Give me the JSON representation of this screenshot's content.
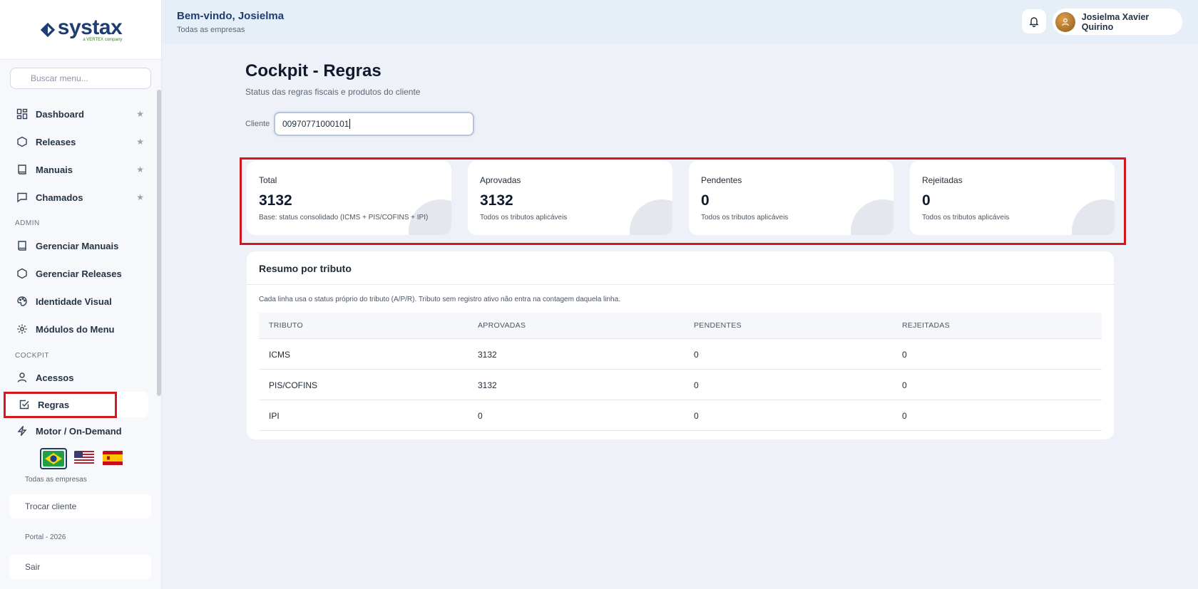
{
  "logo": {
    "text": "systax",
    "sub": "a VERTEX company"
  },
  "sidebar": {
    "search_placeholder": "Buscar menu...",
    "items": [
      {
        "label": "Dashboard",
        "icon": "grid-icon",
        "star": "★"
      },
      {
        "label": "Releases",
        "icon": "hexagon-icon",
        "star": "★"
      },
      {
        "label": "Manuais",
        "icon": "book-icon",
        "star": "★"
      },
      {
        "label": "Chamados",
        "icon": "message-icon",
        "star": "★"
      }
    ],
    "admin_label": "ADMIN",
    "admin_items": [
      {
        "label": "Gerenciar Manuais",
        "icon": "book-icon"
      },
      {
        "label": "Gerenciar Releases",
        "icon": "hexagon-icon"
      },
      {
        "label": "Identidade Visual",
        "icon": "palette-icon"
      },
      {
        "label": "Módulos do Menu",
        "icon": "gear-icon"
      }
    ],
    "cockpit_label": "COCKPIT",
    "cockpit_items": [
      {
        "label": "Acessos",
        "icon": "user-icon"
      },
      {
        "label": "Regras",
        "icon": "checkbox-icon"
      },
      {
        "label": "Motor / On-Demand",
        "icon": "bolt-icon"
      }
    ],
    "empresa_text": "Todas as empresas",
    "trocar_cliente": "Trocar cliente",
    "portal_text": "Portal - 2026",
    "sair": "Sair"
  },
  "header": {
    "welcome": "Bem-vindo, Josielma",
    "subtitle": "Todas as empresas",
    "user_name": "Josielma Xavier Quirino"
  },
  "main": {
    "title": "Cockpit - Regras",
    "subtitle": "Status das regras fiscais e produtos do cliente",
    "cliente_label": "Cliente",
    "cliente_value": "00970771000101"
  },
  "cards": [
    {
      "label": "Total",
      "value": "3132",
      "note": "Base: status consolidado (ICMS + PIS/COFINS + IPI)"
    },
    {
      "label": "Aprovadas",
      "value": "3132",
      "note": "Todos os tributos aplicáveis"
    },
    {
      "label": "Pendentes",
      "value": "0",
      "note": "Todos os tributos aplicáveis"
    },
    {
      "label": "Rejeitadas",
      "value": "0",
      "note": "Todos os tributos aplicáveis"
    }
  ],
  "summary": {
    "title": "Resumo por tributo",
    "note": "Cada linha usa o status próprio do tributo (A/P/R). Tributo sem registro ativo não entra na contagem daquela linha.",
    "headers": [
      "TRIBUTO",
      "APROVADAS",
      "PENDENTES",
      "REJEITADAS"
    ],
    "rows": [
      [
        "ICMS",
        "3132",
        "0",
        "0"
      ],
      [
        "PIS/COFINS",
        "3132",
        "0",
        "0"
      ],
      [
        "IPI",
        "0",
        "0",
        "0"
      ]
    ]
  },
  "colors": {
    "brand": "#1e3d72",
    "highlight": "#d2191f"
  }
}
